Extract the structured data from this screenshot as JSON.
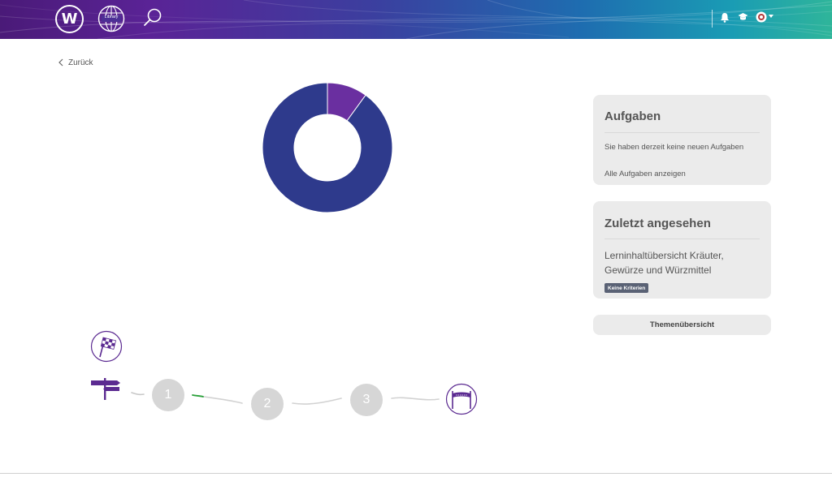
{
  "header": {
    "logo_letter": "W",
    "library_label": "Library",
    "icons": [
      "logo-icon",
      "library-globe-icon",
      "search-icon",
      "bell-icon",
      "graduation-cap-icon",
      "user-avatar-icon",
      "chevron-down-icon"
    ]
  },
  "nav": {
    "back_label": "Zurück"
  },
  "chart_data": {
    "type": "pie",
    "title": "",
    "slices": [
      {
        "value": 10,
        "color": "#6a2fa0"
      },
      {
        "value": 90,
        "color": "#2e3a8c"
      }
    ]
  },
  "progress": {
    "start_icon": "flag-icon",
    "signpost_icon": "signpost-icon",
    "steps": [
      "1",
      "2",
      "3"
    ],
    "finish_icon": "finish-banner-icon"
  },
  "tasks": {
    "title": "Aufgaben",
    "empty_text": "Sie haben derzeit keine neuen Aufgaben",
    "all_link": "Alle Aufgaben anzeigen"
  },
  "recent": {
    "title": "Zuletzt angesehen",
    "item_title": "Lerninhaltübersicht Kräuter, Gewürze und Würzmittel",
    "badge": "Keine Kriterien"
  },
  "themes_button": "Themenübersicht",
  "colors": {
    "accent": "#5b2a91",
    "donut_primary": "#2e3a8c",
    "donut_secondary": "#6a2fa0",
    "step_grey": "#d6d6d6"
  }
}
